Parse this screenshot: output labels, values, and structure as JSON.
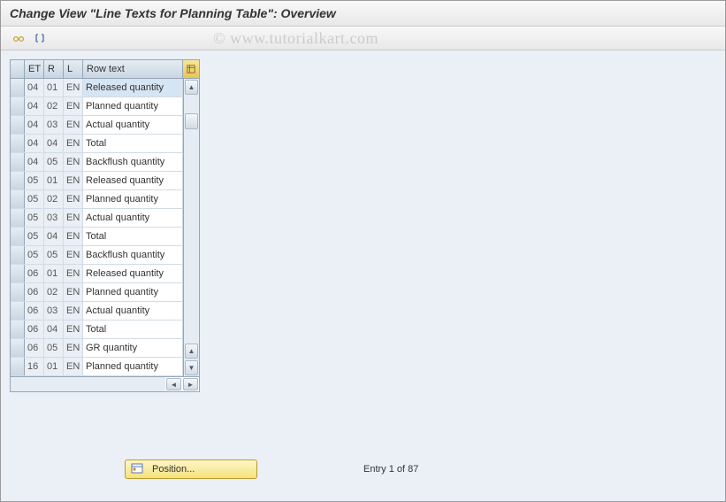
{
  "header": {
    "title": "Change View \"Line Texts for Planning Table\": Overview"
  },
  "toolbar": {
    "btn1": "other-view",
    "btn2": "delimit"
  },
  "watermark": "© www.tutorialkart.com",
  "table": {
    "columns": {
      "et": "ET",
      "r": "R",
      "l": "L",
      "rowtext": "Row text"
    },
    "rows": [
      {
        "et": "04",
        "r": "01",
        "l": "EN",
        "text": "Released quantity",
        "selected": true
      },
      {
        "et": "04",
        "r": "02",
        "l": "EN",
        "text": "Planned quantity"
      },
      {
        "et": "04",
        "r": "03",
        "l": "EN",
        "text": "Actual quantity"
      },
      {
        "et": "04",
        "r": "04",
        "l": "EN",
        "text": "Total"
      },
      {
        "et": "04",
        "r": "05",
        "l": "EN",
        "text": "Backflush quantity"
      },
      {
        "et": "05",
        "r": "01",
        "l": "EN",
        "text": "Released quantity"
      },
      {
        "et": "05",
        "r": "02",
        "l": "EN",
        "text": "Planned quantity"
      },
      {
        "et": "05",
        "r": "03",
        "l": "EN",
        "text": "Actual quantity"
      },
      {
        "et": "05",
        "r": "04",
        "l": "EN",
        "text": "Total"
      },
      {
        "et": "05",
        "r": "05",
        "l": "EN",
        "text": "Backflush quantity"
      },
      {
        "et": "06",
        "r": "01",
        "l": "EN",
        "text": "Released quantity"
      },
      {
        "et": "06",
        "r": "02",
        "l": "EN",
        "text": "Planned quantity"
      },
      {
        "et": "06",
        "r": "03",
        "l": "EN",
        "text": "Actual quantity"
      },
      {
        "et": "06",
        "r": "04",
        "l": "EN",
        "text": "Total"
      },
      {
        "et": "06",
        "r": "05",
        "l": "EN",
        "text": "GR quantity"
      },
      {
        "et": "16",
        "r": "01",
        "l": "EN",
        "text": "Planned quantity"
      }
    ]
  },
  "footer": {
    "position_label": "Position...",
    "entry_text": "Entry 1 of 87"
  }
}
